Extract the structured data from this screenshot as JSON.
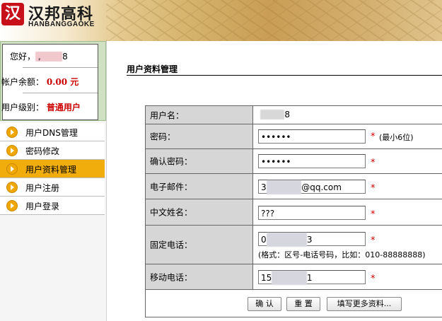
{
  "header": {
    "logo_mark": "汉",
    "brand_cn": "汉邦高科",
    "brand_en": "HANBANGGAOKE"
  },
  "account": {
    "greeting_label": "您好，",
    "username_masked": "8",
    "balance_label": "帐户余额：",
    "balance_value": "0.00 元",
    "level_label": "用户级别：",
    "level_value": "普通用户"
  },
  "menu": [
    {
      "label": "用户DNS管理",
      "active": false
    },
    {
      "label": "密码修改",
      "active": false
    },
    {
      "label": "用户资料管理",
      "active": true
    },
    {
      "label": "用户注册",
      "active": false
    },
    {
      "label": "用户登录",
      "active": false
    }
  ],
  "page": {
    "title": "用户资料管理"
  },
  "form": {
    "username_label": "用户名：",
    "username_value": "8",
    "password_label": "密码：",
    "password_value": "••••••",
    "password_hint": "(最小6位)",
    "confirm_label": "确认密码：",
    "confirm_value": "••••••",
    "email_label": "电子邮件：",
    "email_value": "qq.com",
    "email_prefix": "3",
    "name_label": "中文姓名：",
    "name_value": "???",
    "phone_label": "固定电话：",
    "phone_prefix": "0",
    "phone_suffix": "3",
    "phone_hint": "(格式：区号-电话号码，比如：010-88888888)",
    "mobile_label": "移动电话：",
    "mobile_prefix": "15",
    "mobile_suffix": "1",
    "required_mark": "*"
  },
  "buttons": {
    "confirm": "确 认",
    "reset": "重 置",
    "more": "填写更多资料..."
  },
  "colors": {
    "accent": "#f0ad0c",
    "required": "#d00000",
    "value_red": "#cc0000"
  }
}
